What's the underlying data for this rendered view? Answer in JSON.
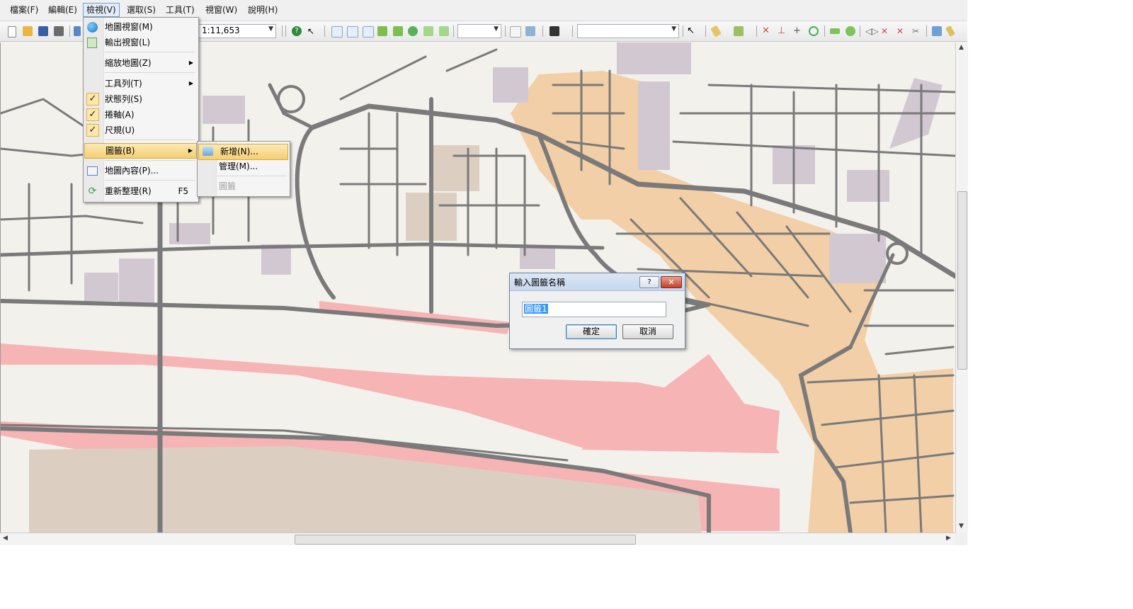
{
  "menubar": {
    "items": [
      "檔案(F)",
      "編輯(E)",
      "檢視(V)",
      "選取(S)",
      "工具(T)",
      "視窗(W)",
      "說明(H)"
    ]
  },
  "toolbar": {
    "scale": "1:11,653",
    "icons": [
      "new-icon",
      "open-icon",
      "save-icon",
      "print-icon",
      "help-icon",
      "whats-this-icon",
      "zoom-in-icon",
      "zoom-out-icon",
      "pan-icon",
      "full-extent-icon",
      "previous-extent-icon",
      "next-extent-icon",
      "camera-icon",
      "select-pointer-icon",
      "draw-line-icon",
      "measure-icon",
      "point-icon",
      "line-icon",
      "polygon-icon",
      "edit-icon"
    ]
  },
  "view_menu": {
    "items": [
      {
        "label": "地圖視窗(M)",
        "icon": "globe-icon"
      },
      {
        "label": "輸出視窗(L)",
        "icon": "output-icon"
      },
      {
        "label": "縮放地圖(Z)",
        "submenu": true
      },
      {
        "label": "工具列(T)",
        "submenu": true
      },
      {
        "label": "狀態列(S)",
        "checked": true
      },
      {
        "label": "捲軸(A)",
        "checked": true
      },
      {
        "label": "尺規(U)",
        "checked": true
      },
      {
        "label": "圖籤(B)",
        "submenu": true,
        "highlighted": true
      },
      {
        "label": "地圖內容(P)...",
        "icon": "map-content-icon"
      },
      {
        "label": "重新整理(R)",
        "shortcut": "F5",
        "icon": "refresh-icon"
      }
    ]
  },
  "bookmark_submenu": {
    "items": [
      {
        "label": "新增(N)...",
        "highlighted": true
      },
      {
        "label": "管理(M)..."
      },
      {
        "label": "圖籤",
        "disabled": true
      }
    ]
  },
  "dialog": {
    "title": "輸入圖籤名稱",
    "help_label": "?",
    "close_label": "✕",
    "input_value": "圖籤1",
    "ok_label": "確定",
    "cancel_label": "取消"
  },
  "colors": {
    "map_background": "#f3f1ec",
    "road": "#7a7a7a",
    "residential_orange": "#f2cfa6",
    "river_pink": "#f6b4b4",
    "building_purple": "#d2c8d2",
    "sand": "#dccfc2"
  }
}
